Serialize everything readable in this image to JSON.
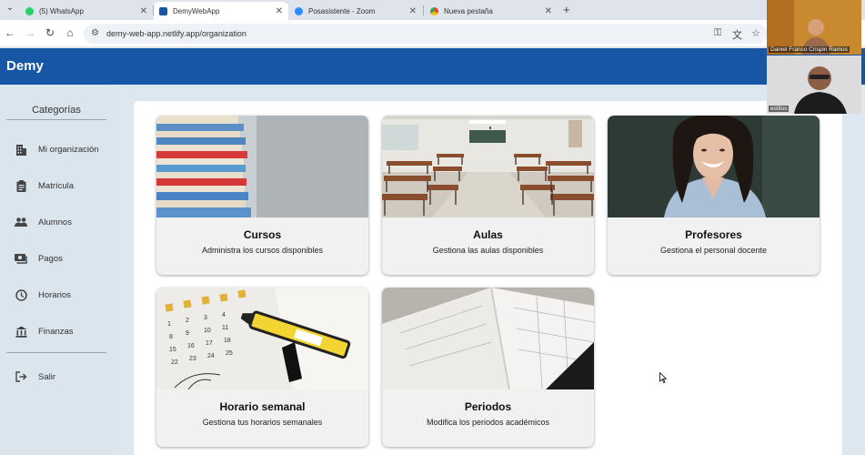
{
  "browser": {
    "tabs": [
      {
        "label": "(5) WhatsApp",
        "active": false,
        "color": "#25d366"
      },
      {
        "label": "DemyWebApp",
        "active": true,
        "color": "#1656a5"
      },
      {
        "label": "Posasistente - Zoom",
        "active": false,
        "color": "#2d8cff"
      },
      {
        "label": "Nueva pestaña",
        "active": false,
        "color": "#777777"
      }
    ],
    "url": "demy-web-app.netlify.app/organization"
  },
  "app": {
    "brand": "Demy",
    "brand_color": "#1656a5"
  },
  "sidebar": {
    "title": "Categorías",
    "items": [
      {
        "label": "Mi organización",
        "icon": "building-icon"
      },
      {
        "label": "Matrícula",
        "icon": "clipboard-icon"
      },
      {
        "label": "Alumnos",
        "icon": "people-icon"
      },
      {
        "label": "Pagos",
        "icon": "payments-icon"
      },
      {
        "label": "Horarios",
        "icon": "clock-icon"
      },
      {
        "label": "Finanzas",
        "icon": "bank-icon"
      }
    ],
    "logout": {
      "label": "Salir",
      "icon": "logout-icon"
    }
  },
  "cards": [
    {
      "title": "Cursos",
      "description": "Administra los cursos disponibles",
      "image": "stacked-books"
    },
    {
      "title": "Aulas",
      "description": "Gestiona las aulas disponibles",
      "image": "classroom"
    },
    {
      "title": "Profesores",
      "description": "Gestiona el personal docente",
      "image": "smiling-teacher"
    },
    {
      "title": "Horario semanal",
      "description": "Gestiona tus horarios semanales",
      "image": "calendar-notebook-marker"
    },
    {
      "title": "Periodos",
      "description": "Modifica los periodos académicos",
      "image": "open-planner"
    }
  ],
  "video_call": {
    "participants": [
      {
        "name": "Daniel Franco Crispin Ramos"
      },
      {
        "name": "estilos"
      }
    ]
  }
}
